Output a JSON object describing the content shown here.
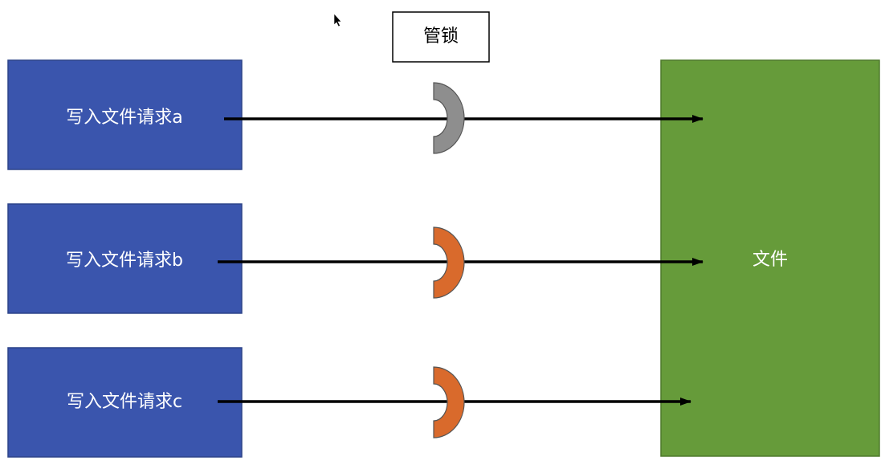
{
  "lock_title": "管锁",
  "target": {
    "label": "文件",
    "color": "#669b3a",
    "border": "#4f7a2c"
  },
  "requests": [
    {
      "label": "写入文件请求a",
      "lock_state": "released"
    },
    {
      "label": "写入文件请求b",
      "lock_state": "held"
    },
    {
      "label": "写入文件请求c",
      "lock_state": "held"
    }
  ],
  "colors": {
    "request_fill": "#3a55ad",
    "request_border": "#2c4389",
    "lock_released": "#8e8e8e",
    "lock_held": "#d96a2c",
    "lock_outline": "#555555",
    "arrow": "#000000"
  },
  "icons": {
    "cursor": "mouse-pointer-icon"
  }
}
